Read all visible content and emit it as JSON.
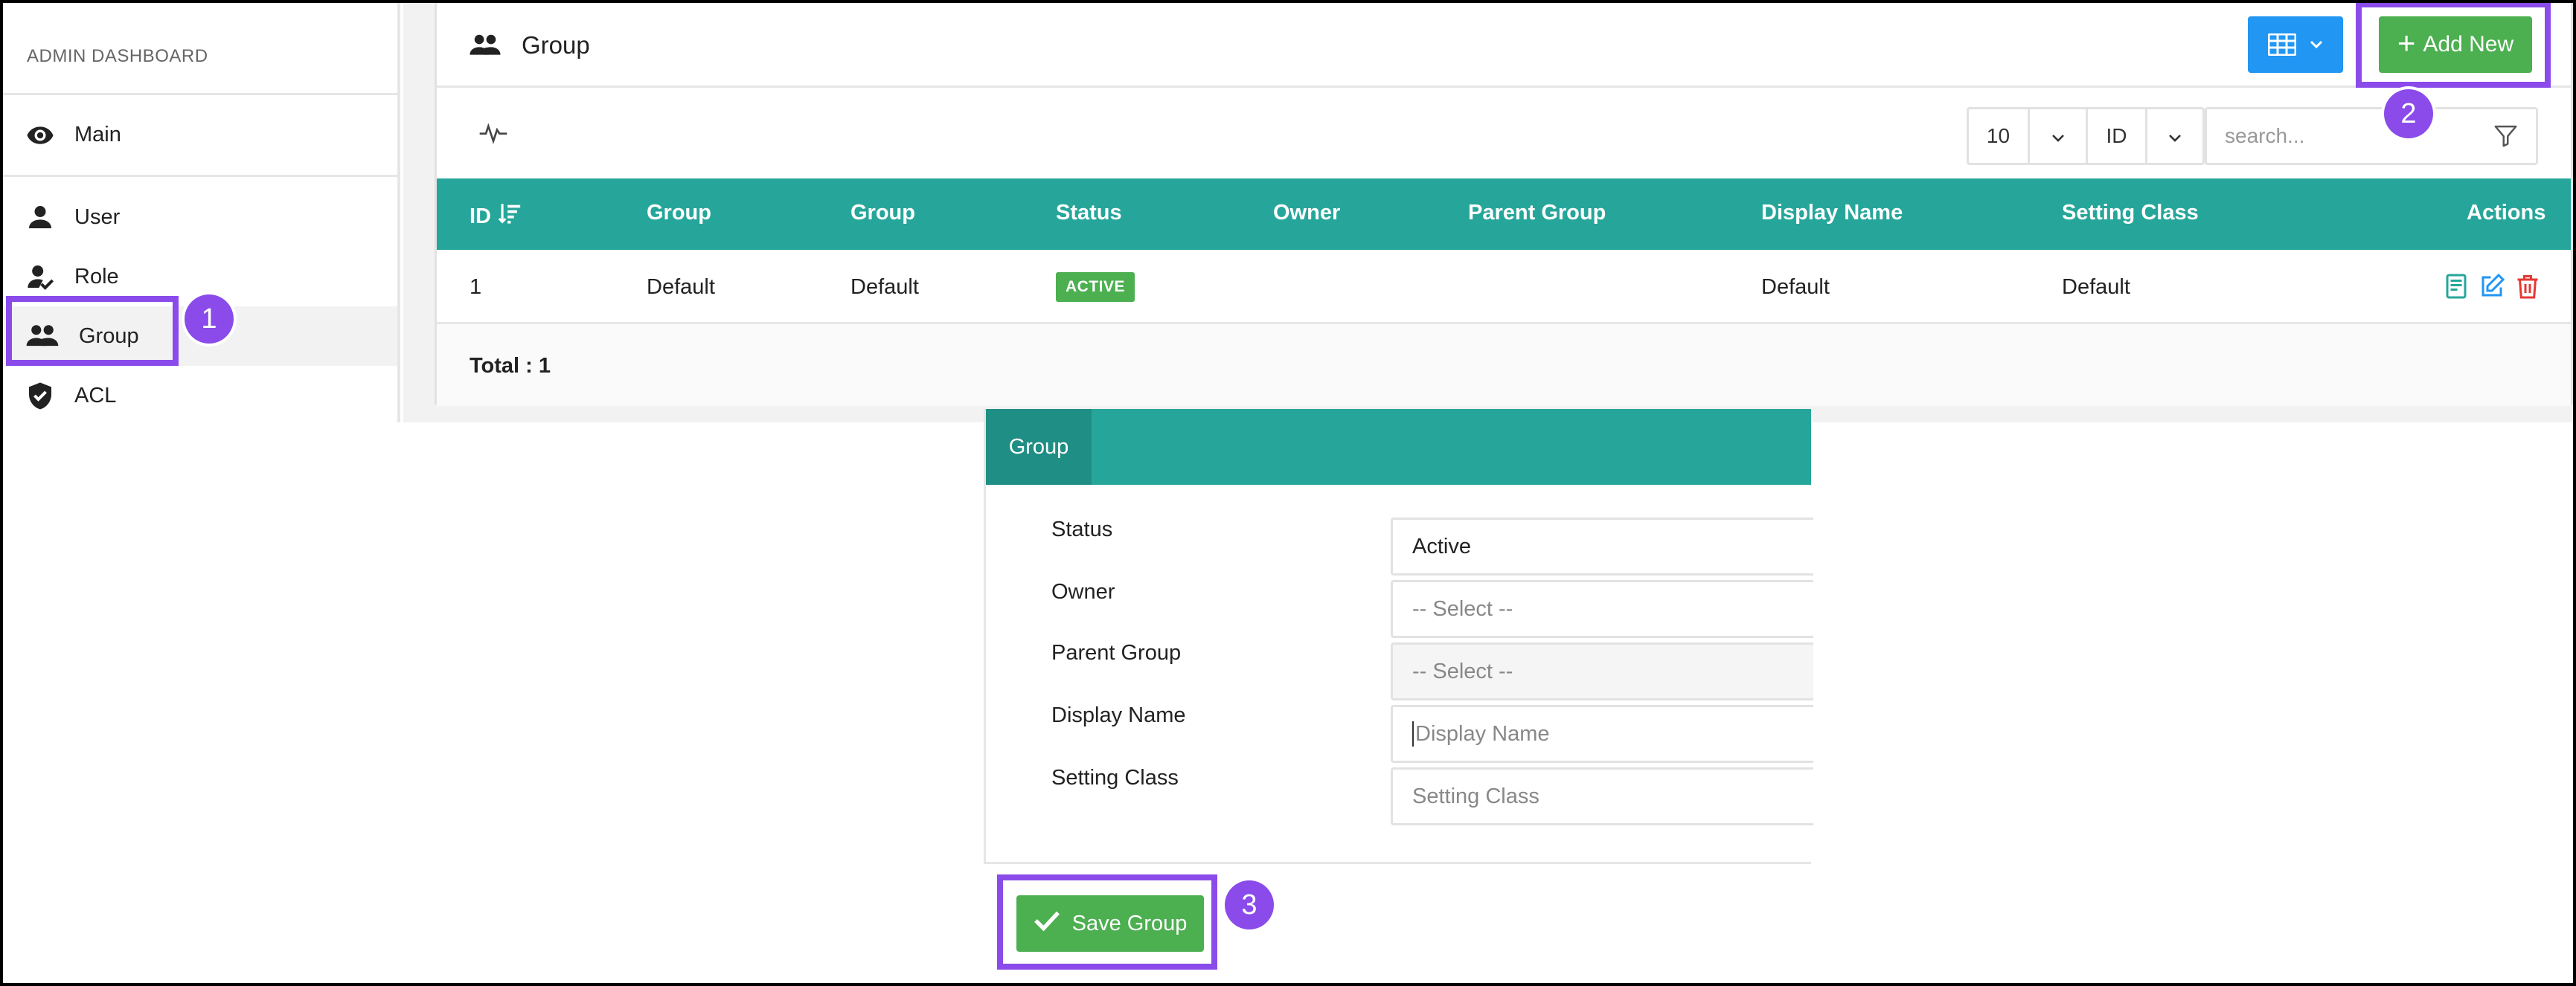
{
  "sidebar": {
    "header": "ADMIN DASHBOARD",
    "main_label": "Main",
    "items": [
      {
        "label": "User",
        "icon": "user-icon"
      },
      {
        "label": "Role",
        "icon": "role-icon"
      },
      {
        "label": "Group",
        "icon": "group-icon",
        "active": true
      },
      {
        "label": "ACL",
        "icon": "shield-icon"
      }
    ]
  },
  "header": {
    "title": "Group",
    "add_new_label": "Add New"
  },
  "toolbar": {
    "page_size": "10",
    "sort_field": "ID",
    "search_placeholder": "search..."
  },
  "table": {
    "columns": [
      "ID",
      "Group",
      "Group",
      "Status",
      "Owner",
      "Parent Group",
      "Display Name",
      "Setting Class",
      "Actions"
    ],
    "rows": [
      {
        "id": "1",
        "group": "Default",
        "group2": "Default",
        "status": "ACTIVE",
        "owner": "",
        "parent_group": "",
        "display_name": "Default",
        "setting_class": "Default"
      }
    ],
    "total": "Total : 1"
  },
  "form": {
    "tab": "Group",
    "fields": [
      {
        "label": "Status",
        "value": "Active"
      },
      {
        "label": "Owner",
        "value": "-- Select --"
      },
      {
        "label": "Parent Group",
        "value": "-- Select --"
      },
      {
        "label": "Display Name",
        "placeholder": "Display Name"
      },
      {
        "label": "Setting Class",
        "placeholder": "Setting Class"
      }
    ],
    "save_label": "Save Group"
  },
  "annotations": [
    "1",
    "2",
    "3"
  ],
  "colors": {
    "accent_teal": "#26a69a",
    "success_green": "#4caf50",
    "primary_blue": "#2196f3",
    "annotation_purple": "#8a4bea",
    "danger_red": "#e53935"
  }
}
